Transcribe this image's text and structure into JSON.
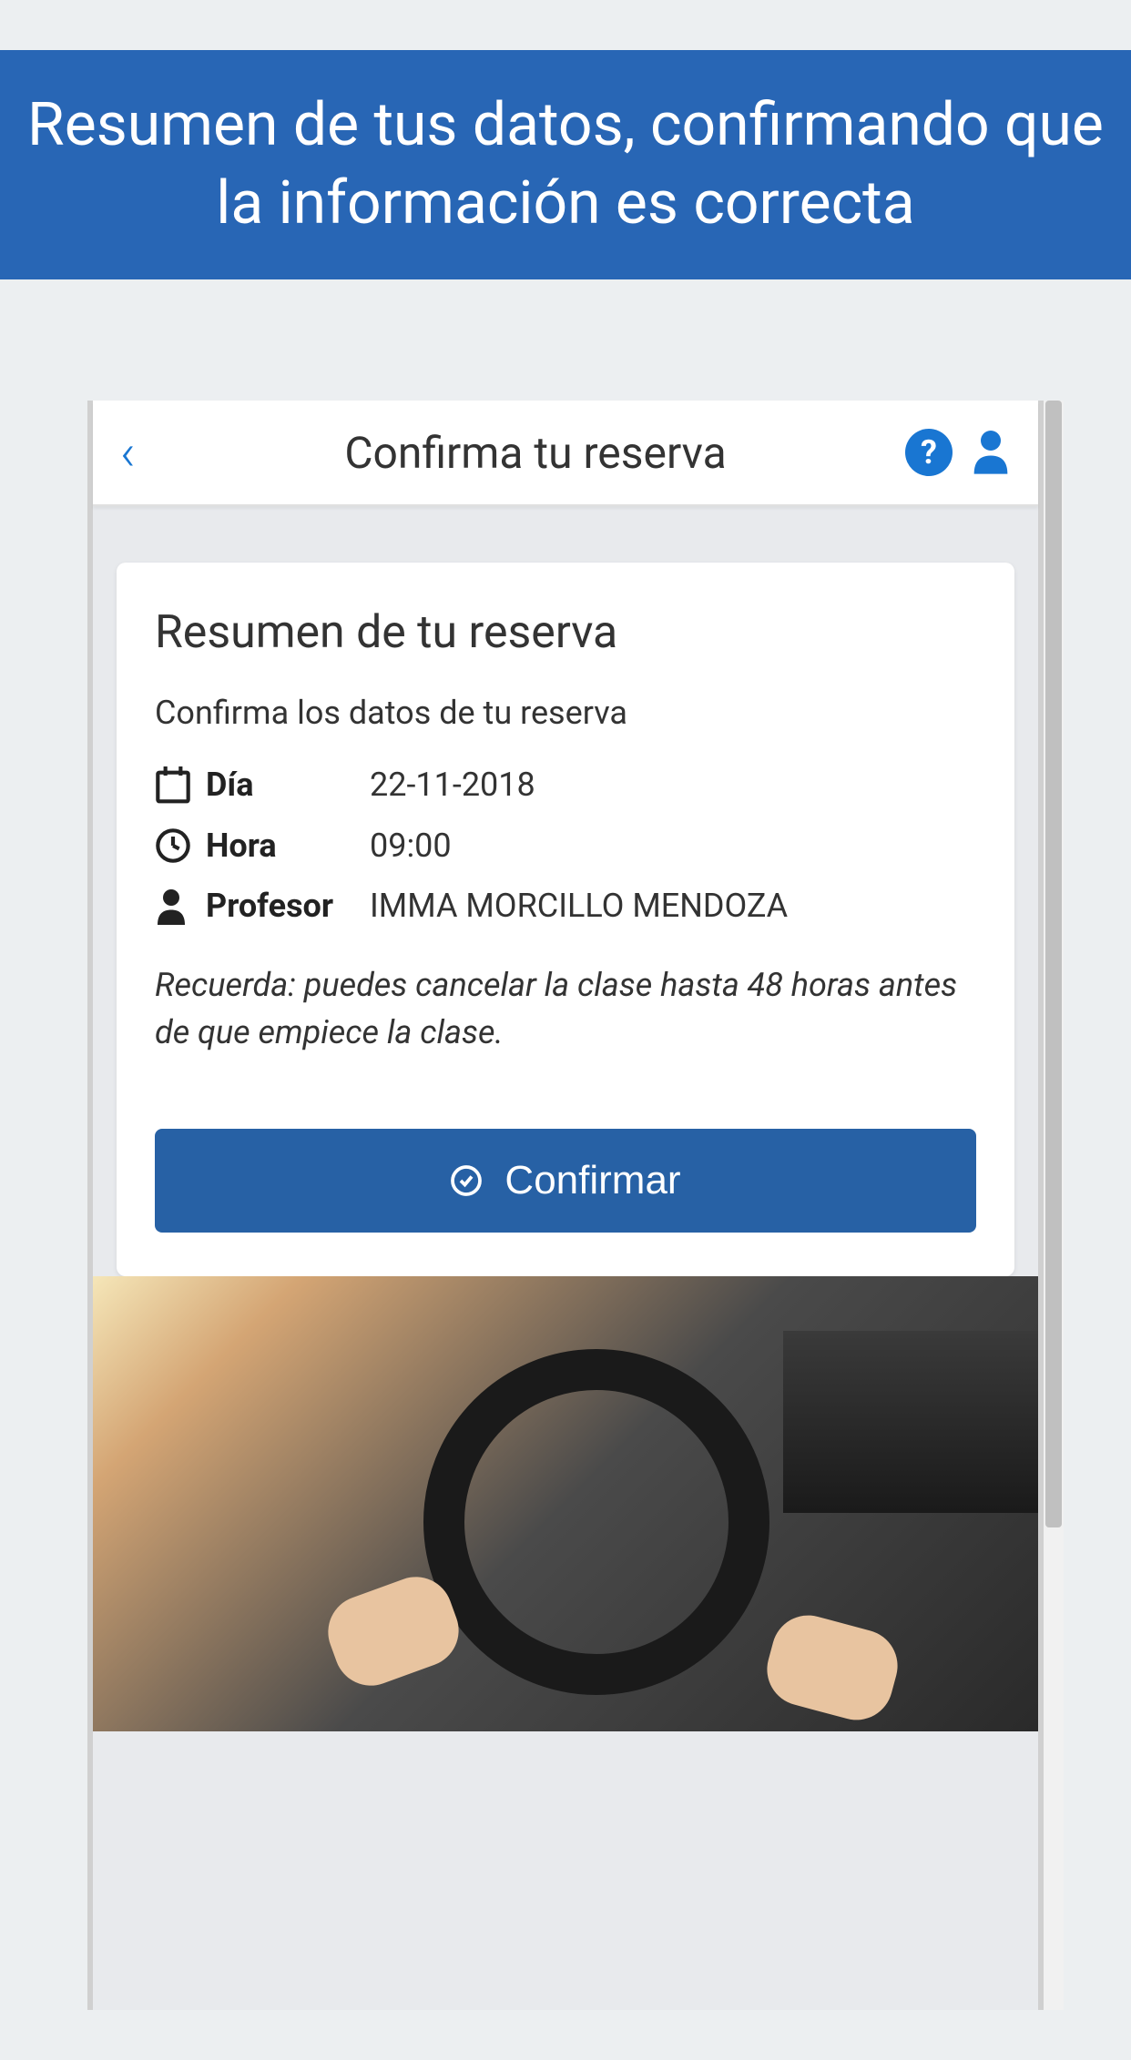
{
  "banner": {
    "text": "Resumen de tus datos, confirmando que la información es correcta"
  },
  "header": {
    "title": "Confirma tu reserva",
    "help_label": "?",
    "back_icon": "‹"
  },
  "card": {
    "title": "Resumen de tu reserva",
    "subtitle": "Confirma los datos de tu reserva",
    "details": {
      "day_label": "Día",
      "day_value": "22-11-2018",
      "time_label": "Hora",
      "time_value": "09:00",
      "teacher_label": "Profesor",
      "teacher_value": "IMMA MORCILLO MENDOZA"
    },
    "reminder": "Recuerda: puedes cancelar la clase hasta 48 horas antes de que empiece la clase.",
    "confirm_label": "Confirmar"
  }
}
